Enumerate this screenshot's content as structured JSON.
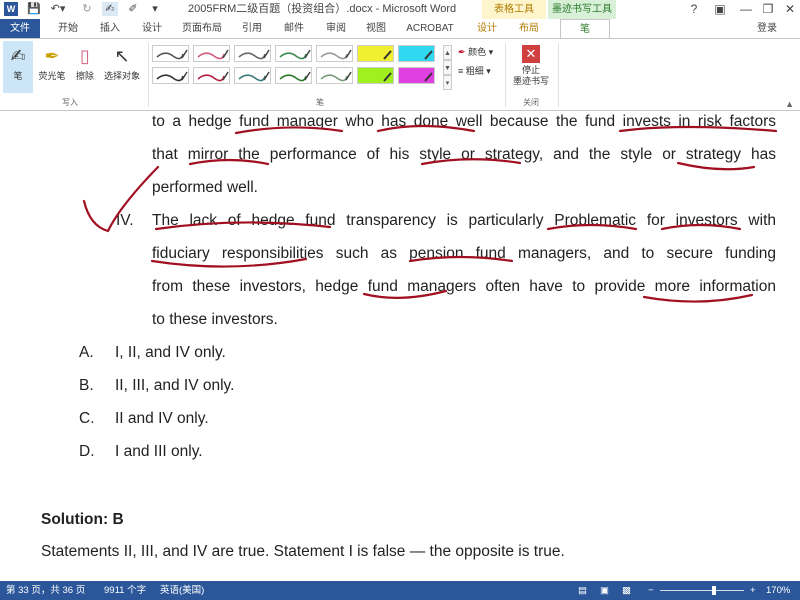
{
  "titlebar": {
    "doc_title": "2005FRM二级百题（投资组合）.docx - Microsoft Word",
    "context_tab_table": "表格工具",
    "context_tab_ink": "墨迹书写工具",
    "help": "?",
    "minimize": "—",
    "restore": "❐",
    "close": "✕"
  },
  "tabs": {
    "file": "文件",
    "home": "开始",
    "insert": "插入",
    "design": "设计",
    "layout": "页面布局",
    "references": "引用",
    "mailings": "邮件",
    "review": "审阅",
    "view": "视图",
    "acrobat": "ACROBAT",
    "table_design": "设计",
    "table_layout": "布局",
    "pen": "笔",
    "login": "登录"
  },
  "ribbon": {
    "write_group": {
      "label": "写入",
      "pen": "笔",
      "highlighter": "荧光笔",
      "eraser": "擦除",
      "select": "选择对象"
    },
    "pens_group": {
      "label": "笔"
    },
    "color": "颜色",
    "thickness": "粗细",
    "close_group": {
      "label": "关闭",
      "stop_line1": "停止",
      "stop_line2": "墨迹书写"
    },
    "pen_colors": [
      "#555555",
      "#d05a7a",
      "#666666",
      "#3a8a4a",
      "#999999",
      "#f0f030",
      "#30d8f0",
      "#333333",
      "#b02040",
      "#3a7a7a",
      "#2a7a2a",
      "#7a9a7a",
      "#a0f020",
      "#e040e0"
    ]
  },
  "document": {
    "lines": [
      "to a hedge fund manager who has done well because the fund invests in risk factors",
      "that mirror the performance of his style or strategy, and the style or strategy has",
      "performed well.",
      "The lack of hedge fund transparency is particularly Problematic for investors with",
      "fiduciary responsibilities such as pension fund managers, and to secure funding",
      "from these investors, hedge fund managers often have to provide more information",
      "to these investors."
    ],
    "item_number": "IV.",
    "options": [
      {
        "letter": "A.",
        "text": "I, II, and IV only."
      },
      {
        "letter": "B.",
        "text": "II, III, and IV only."
      },
      {
        "letter": "C.",
        "text": "II and IV only."
      },
      {
        "letter": "D.",
        "text": "I and III only."
      }
    ],
    "solution": "Solution: B",
    "explanation": "Statements II, III, and IV are true. Statement I is false — the opposite is true.",
    "ink_color": "#a01020"
  },
  "status": {
    "page": "第 33 页，共 36 页",
    "words": "9911 个字",
    "language": "英语(美国)",
    "zoom": "170%",
    "zoom_minus": "−",
    "zoom_plus": "+"
  }
}
